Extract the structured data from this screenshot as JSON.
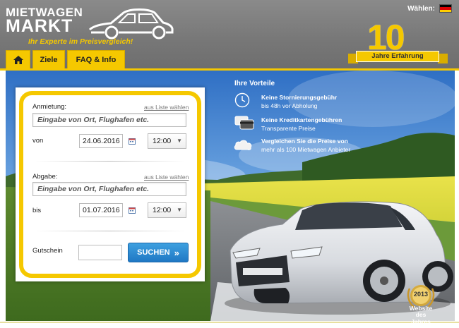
{
  "header": {
    "logo_line1": "MIETWAGEN",
    "logo_line2": "MARKT",
    "tagline": "Ihr Experte im Preisvergleich!",
    "lang_label": "Wählen:",
    "badge_number": "10",
    "badge_ribbon": "Jahre Erfahrung"
  },
  "nav": {
    "home_icon": "home-icon",
    "tabs": [
      {
        "label": "Ziele"
      },
      {
        "label": "FAQ & Info"
      }
    ]
  },
  "form": {
    "pickup_label": "Anmietung:",
    "pickup_list_link": "aus Liste wählen",
    "pickup_placeholder": "Eingabe von Ort, Flughafen etc.",
    "from_label": "von",
    "from_date": "24.06.2016",
    "from_time": "12:00",
    "return_label": "Abgabe:",
    "return_list_link": "aus Liste wählen",
    "return_placeholder": "Eingabe von Ort, Flughafen etc.",
    "to_label": "bis",
    "to_date": "01.07.2016",
    "to_time": "12:00",
    "voucher_label": "Gutschein",
    "voucher_value": "",
    "search_label": "SUCHEN"
  },
  "benefits": {
    "title": "Ihre Vorteile",
    "items": [
      {
        "icon": "clock-icon",
        "title": "Keine Stornierungsgebühr",
        "subtitle": "bis 48h vor Abholung"
      },
      {
        "icon": "credit-card-icon",
        "title": "Keine Kreditkartengebühren",
        "subtitle": "Transparente Preise"
      },
      {
        "icon": "cloud-compare-icon",
        "title": "Vergleichen Sie die Preise von",
        "subtitle": "mehr als 100 Mietwagen Anbieter"
      }
    ]
  },
  "award": {
    "year": "2013",
    "line1": "Website",
    "line2": "des Jahres"
  },
  "colors": {
    "brand_yellow": "#f5c800",
    "header_gray": "#7a7a7a",
    "button_blue": "#2a8bd6"
  }
}
